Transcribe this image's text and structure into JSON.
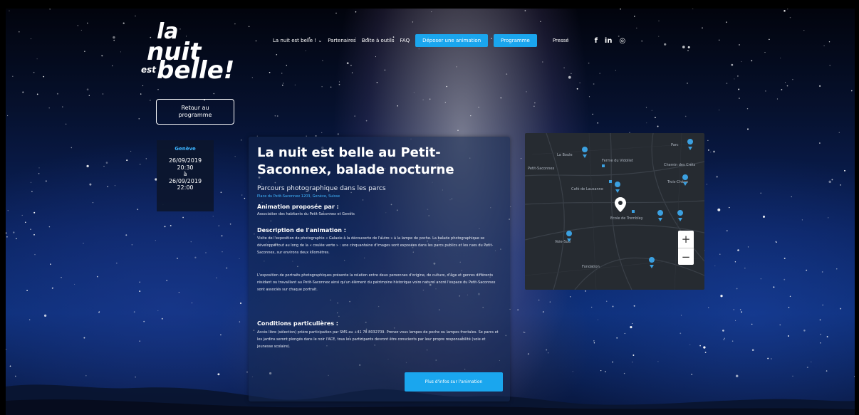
{
  "logo": {
    "line1": "la",
    "line2": "nuit",
    "line3": "est",
    "line4": "belle!"
  },
  "nav": {
    "items": [
      "La nuit est belle ! ⌄",
      "Partenaires",
      "Boite à outils",
      "FAQ"
    ],
    "btn_deposer": "Déposer une animation",
    "btn_programme": "Programme",
    "presse": "Presse",
    "social": [
      "f",
      "in",
      "◎"
    ]
  },
  "back": {
    "line1": "Retour au",
    "line2": "programme"
  },
  "date": {
    "city": "Genève",
    "start_date": "26/09/2019",
    "start_time": "20:30",
    "sep": "à",
    "end_date": "26/09/2019",
    "end_time": "22:00"
  },
  "event": {
    "title": "La nuit est belle au Petit-Saconnex, balade nocturne",
    "subtitle": "Parcours photographique dans les parcs",
    "place": "Place du Petit-Saconnex 1203, Genève, Suisse",
    "proposed_heading": "Animation proposée par :",
    "proposed_text": "Association des habitants du Petit-Saconnex et Genêts",
    "desc_heading": "Description de l'animation :",
    "desc_p1": "Visite de l'exposition de photographie « Galaxie à la découverte de l'autre » à la lampe de poche. La balade photographique se développe tout au long de la « coulée verte » : une cinquantaine d'images sont exposées dans les parcs publics et les rues du Petit-Saconnex, sur environs deux kilomètres.",
    "desc_p2": "L'exposition de portraits photographiques présente la relation entre deux personnes d'origine, de culture, d'âge et genres différents résidant ou travaillant au Petit-Saconnex ainsi qu'un élément du patrimoine historique voire naturel ancré l'espace du Petit-Saconnex sont associés sur chaque portrait.",
    "cond_heading": "Conditions particulières :",
    "cond_text": "Accès libre (sélection) prière participation par SMS au +41 78 8032709. Prenez vous lampes de poche ou lampes frontales. Se parcs et les jardins seront plongés dans le noir l'ACE, tous les participants devront être conscients par leur propre responsabilité (voie et jeunesse scolaire).",
    "more_btn": "Plus d'infos sur l'animation"
  },
  "map": {
    "labels": [
      "La Boule",
      "Ferme du Vidollet",
      "Petit-Saconnex",
      "Parc",
      "Chemin des Crêts",
      "Trois-Chêne",
      "Café de Lausanne",
      "Voie-Sud",
      "Ecole de Trembley",
      "Fondation"
    ],
    "zoom_in": "+",
    "zoom_out": "−"
  },
  "colors": {
    "accent": "#1aa6ee",
    "sky_dark": "#02040d",
    "sky_blue": "#0d2f78",
    "map_bg": "#262b31",
    "pin": "#3ba0e0"
  }
}
